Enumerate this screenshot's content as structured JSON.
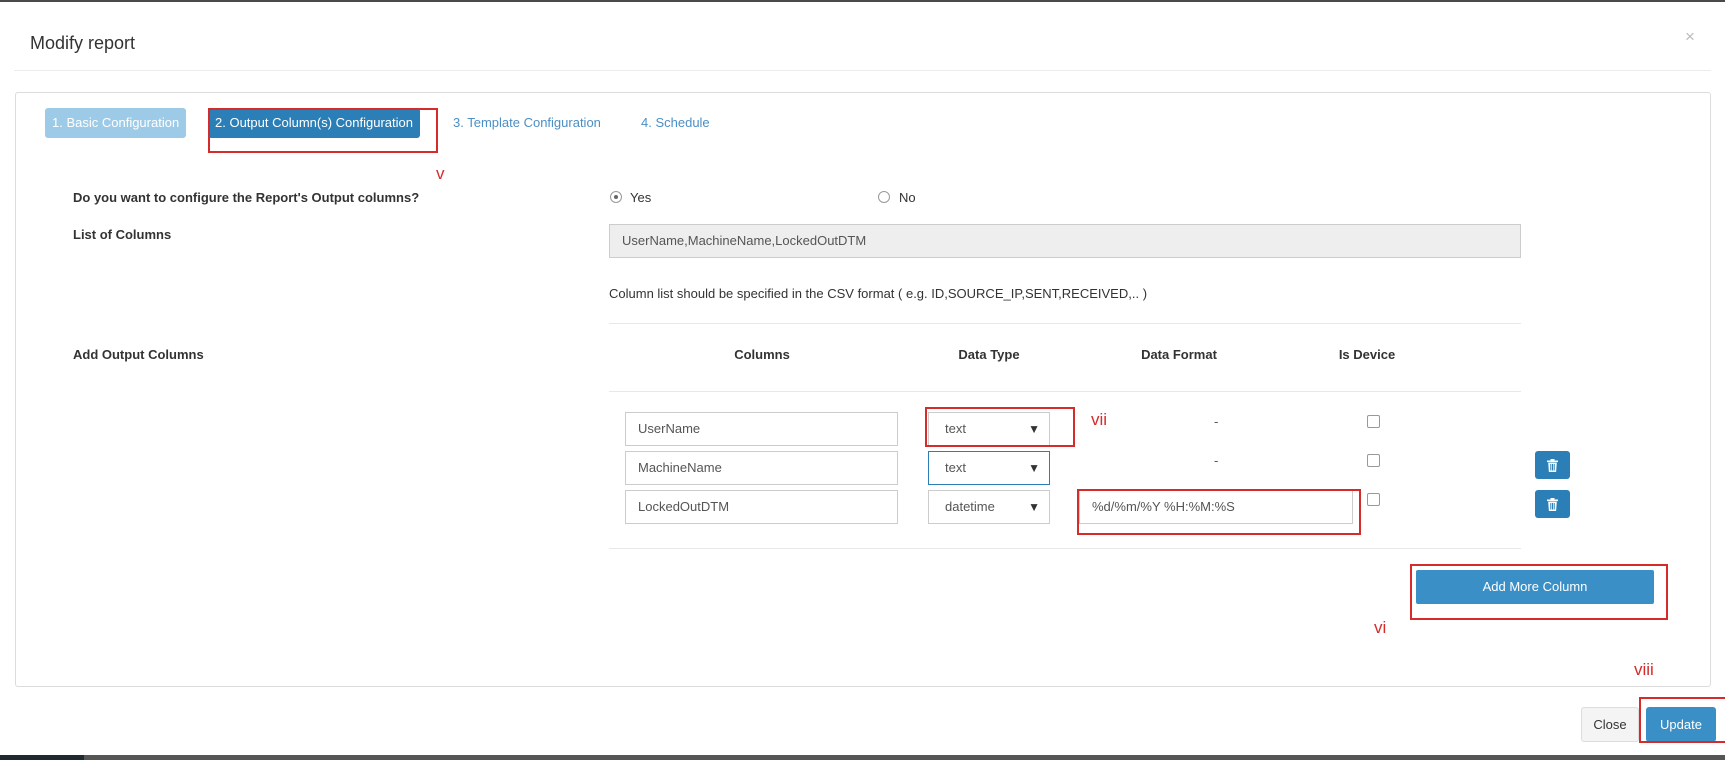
{
  "modal": {
    "title": "Modify report",
    "close_symbol": "×"
  },
  "steps": [
    {
      "label": "1. Basic Configuration",
      "state": "done"
    },
    {
      "label": "2. Output Column(s) Configuration",
      "state": "active"
    },
    {
      "label": "3. Template Configuration",
      "state": "pending"
    },
    {
      "label": "4. Schedule",
      "state": "pending"
    }
  ],
  "form": {
    "configure_question": "Do you want to configure the Report's Output columns?",
    "options": [
      {
        "label": "Yes",
        "checked": true
      },
      {
        "label": "No",
        "checked": false
      }
    ],
    "list_label": "List of Columns",
    "list_value": "UserName,MachineName,LockedOutDTM",
    "list_hint": "Column list should be specified in the CSV format ( e.g. ID,SOURCE_IP,SENT,RECEIVED,.. )",
    "add_output_label": "Add Output Columns"
  },
  "table": {
    "headers": {
      "columns": "Columns",
      "data_type": "Data Type",
      "data_format": "Data Format",
      "is_device": "Is Device"
    },
    "rows": [
      {
        "column": "UserName",
        "type": "text",
        "format": "-",
        "is_device": false
      },
      {
        "column": "MachineName",
        "type": "text",
        "format": "-",
        "is_device": false
      },
      {
        "column": "LockedOutDTM",
        "type": "datetime",
        "format": "%d/%m/%Y %H:%M:%S",
        "is_device": false
      }
    ],
    "caret": "▼"
  },
  "buttons": {
    "add_more": "Add More Column",
    "close": "Close",
    "update": "Update"
  },
  "annotations": {
    "v": "v",
    "vi": "vi",
    "vii": "vii",
    "viii": "viii"
  },
  "colors": {
    "primary": "#2b7fb6",
    "annotation": "#d52b2b",
    "step_done": "#9dcbe7"
  },
  "icons": {
    "trash": "trash-icon"
  }
}
